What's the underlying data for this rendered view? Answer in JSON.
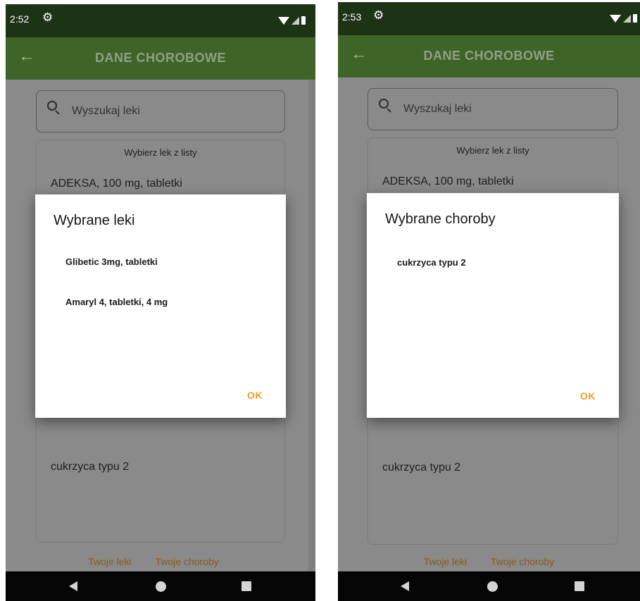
{
  "left_screen": {
    "status_bar": {
      "time": "2:52"
    },
    "app_bar": {
      "title": "DANE CHOROBOWE"
    },
    "search": {
      "placeholder": "Wyszukaj leki"
    },
    "list": {
      "header": "Wybierz lek z listy",
      "top_item": "ADEKSA, 100 mg, tabletki",
      "bottom_item": "cukrzyca typu 2"
    },
    "tabs": [
      "Twoje leki",
      "Twoje choroby"
    ],
    "dialog": {
      "title": "Wybrane leki",
      "items": [
        "Glibetic 3mg, tabletki",
        "Amaryl 4, tabletki, 4 mg"
      ],
      "ok_label": "OK"
    }
  },
  "right_screen": {
    "status_bar": {
      "time": "2:53"
    },
    "app_bar": {
      "title": "DANE CHOROBOWE"
    },
    "search": {
      "placeholder": "Wyszukaj leki"
    },
    "list": {
      "header": "Wybierz lek z listy",
      "top_item": "ADEKSA, 100 mg, tabletki",
      "bottom_item": "cukrzyca typu 2"
    },
    "tabs": [
      "Twoje leki",
      "Twoje choroby"
    ],
    "dialog": {
      "title": "Wybrane choroby",
      "items": [
        "cukrzyca typu 2"
      ],
      "ok_label": "OK"
    }
  },
  "icons": {
    "status": [
      "gear-icon",
      "wifi-icon",
      "signal-icon",
      "battery-icon"
    ],
    "app_bar": "back-arrow-icon",
    "search": "search-icon",
    "nav": [
      "nav-back-icon",
      "nav-home-icon",
      "nav-recents-icon"
    ]
  },
  "colors": {
    "status_bar": "#1d3315",
    "app_bar": "#3f6428",
    "accent_ok": "#f29b24",
    "tab_text": "#8a5a1c",
    "scrim_background": "#8a8a8a",
    "nav_bar": "#050505"
  }
}
